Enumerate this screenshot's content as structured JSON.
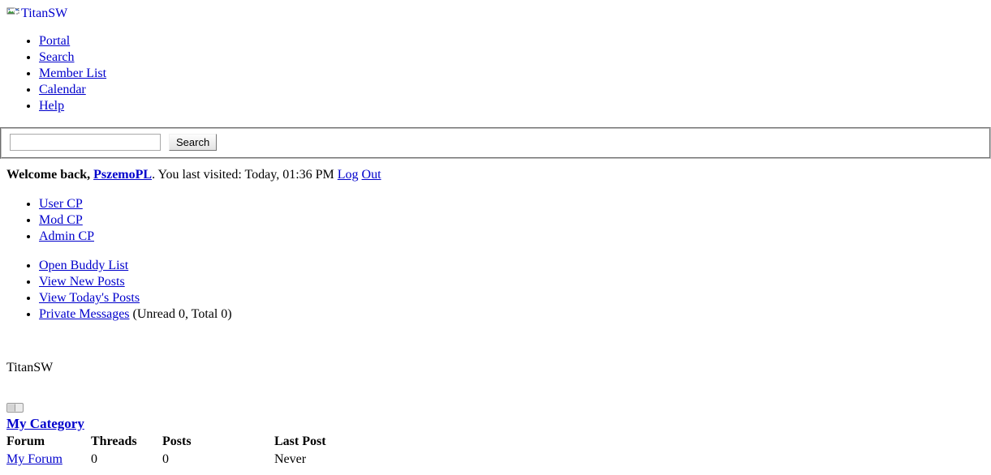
{
  "header": {
    "logo_alt": "TitanSW",
    "logo_icon": "broken-image-icon"
  },
  "nav": {
    "items": [
      {
        "label": "Portal"
      },
      {
        "label": "Search"
      },
      {
        "label": "Member List"
      },
      {
        "label": "Calendar"
      },
      {
        "label": "Help"
      }
    ]
  },
  "search": {
    "value": "",
    "placeholder": "",
    "button_label": "Search"
  },
  "welcome": {
    "greeting": "Welcome back,",
    "username": "PszemoPL",
    "visited_text": ". You last visited: Today, 01:36 PM",
    "logout_part1": "Log",
    "logout_part2": "Out"
  },
  "user_panel": {
    "cp_items": [
      {
        "label": "User CP"
      },
      {
        "label": "Mod CP"
      },
      {
        "label": "Admin CP"
      }
    ],
    "quick_items": [
      {
        "label": "Open Buddy List",
        "suffix": ""
      },
      {
        "label": "View New Posts",
        "suffix": ""
      },
      {
        "label": "View Today's Posts",
        "suffix": ""
      },
      {
        "label": "Private Messages",
        "suffix": " (Unread 0, Total 0)"
      }
    ]
  },
  "breadcrumb": {
    "text": "TitanSW"
  },
  "category": {
    "toggle_icon": "collapse-toggle-icon",
    "name": "My Category",
    "columns": [
      "Forum",
      "Threads",
      "Posts",
      "Last Post"
    ],
    "rows": [
      {
        "forum": "My Forum",
        "threads": "0",
        "posts": "0",
        "lastpost": "Never"
      }
    ]
  },
  "colors": {
    "link": "#0000cc",
    "text": "#000000",
    "background": "#ffffff",
    "border": "#c0c0c0"
  }
}
